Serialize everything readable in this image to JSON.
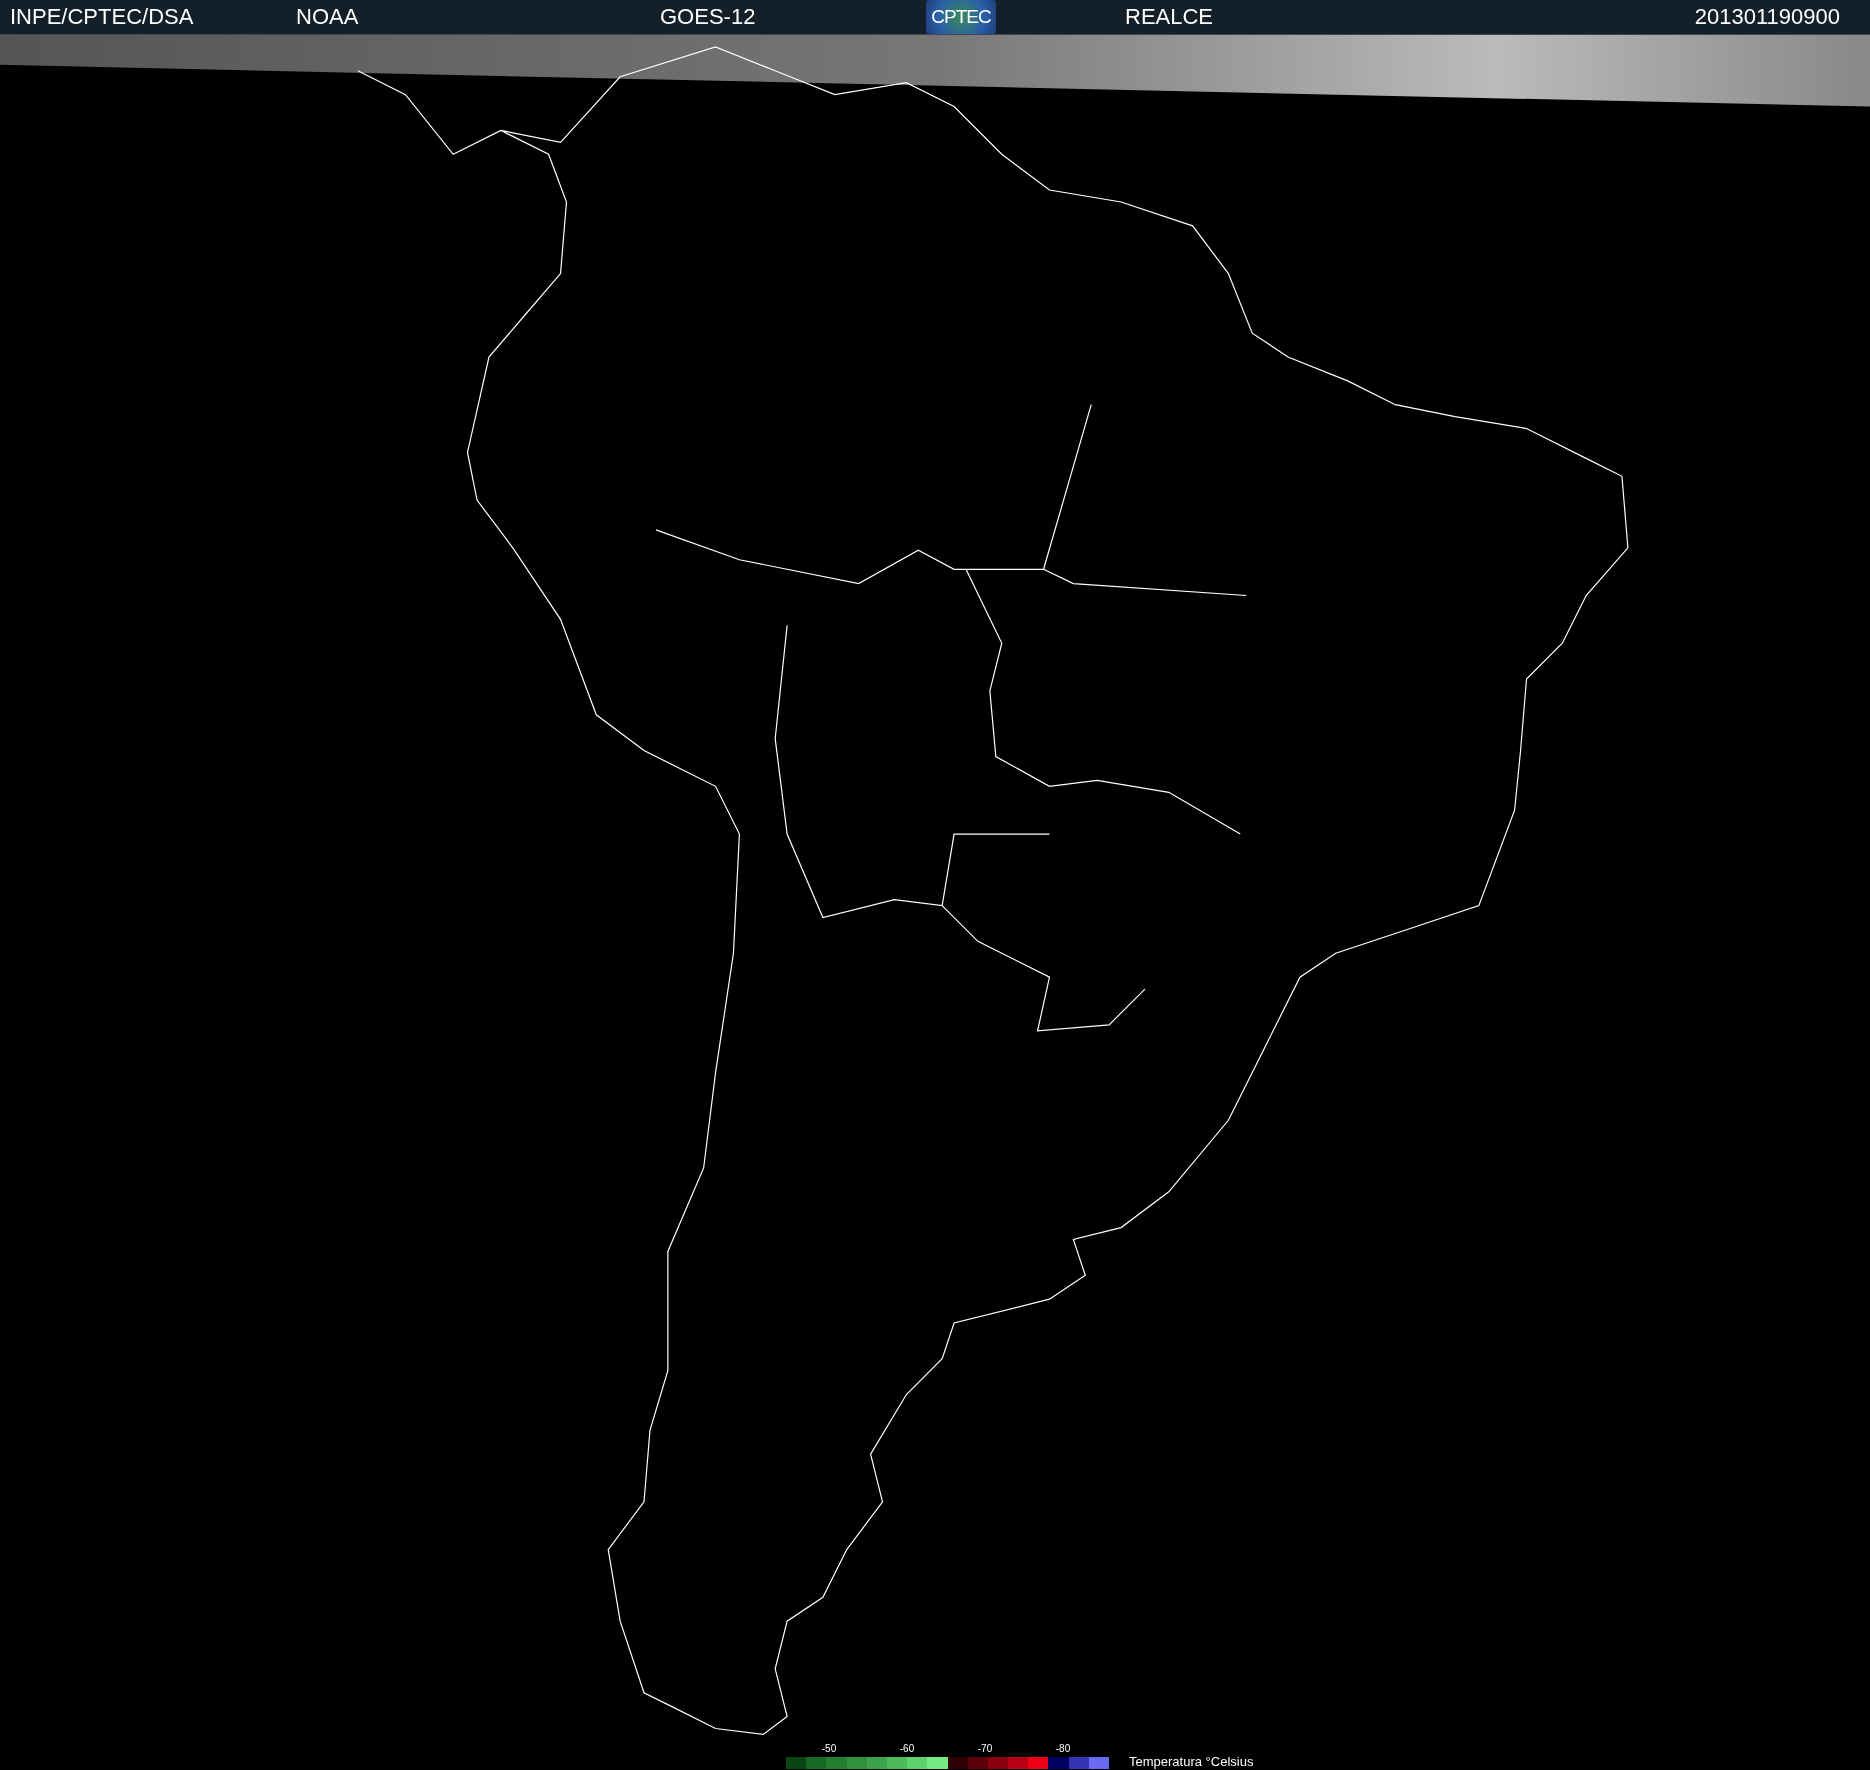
{
  "header": {
    "institution": "INPE/CPTEC/DSA",
    "agency": "NOAA",
    "satellite": "GOES-12",
    "logo": "CPTEC",
    "product": "REALCE",
    "timestamp": "201301190900"
  },
  "legend": {
    "ticks": [
      "-50",
      "-60",
      "-70",
      "-80"
    ],
    "title": "Temperatura °Celsius",
    "swatches": [
      {
        "color": "#0b4514"
      },
      {
        "color": "#176a22"
      },
      {
        "color": "#247f30"
      },
      {
        "color": "#30913d"
      },
      {
        "color": "#3da34a"
      },
      {
        "color": "#4cbb5a"
      },
      {
        "color": "#5ed06c"
      },
      {
        "color": "#74ea82"
      },
      {
        "color": "#300008"
      },
      {
        "color": "#5c000c"
      },
      {
        "color": "#8a0010"
      },
      {
        "color": "#b80012"
      },
      {
        "color": "#ee0014"
      },
      {
        "color": "#000060"
      },
      {
        "color": "#3434b4"
      },
      {
        "color": "#6a6af2"
      }
    ]
  }
}
